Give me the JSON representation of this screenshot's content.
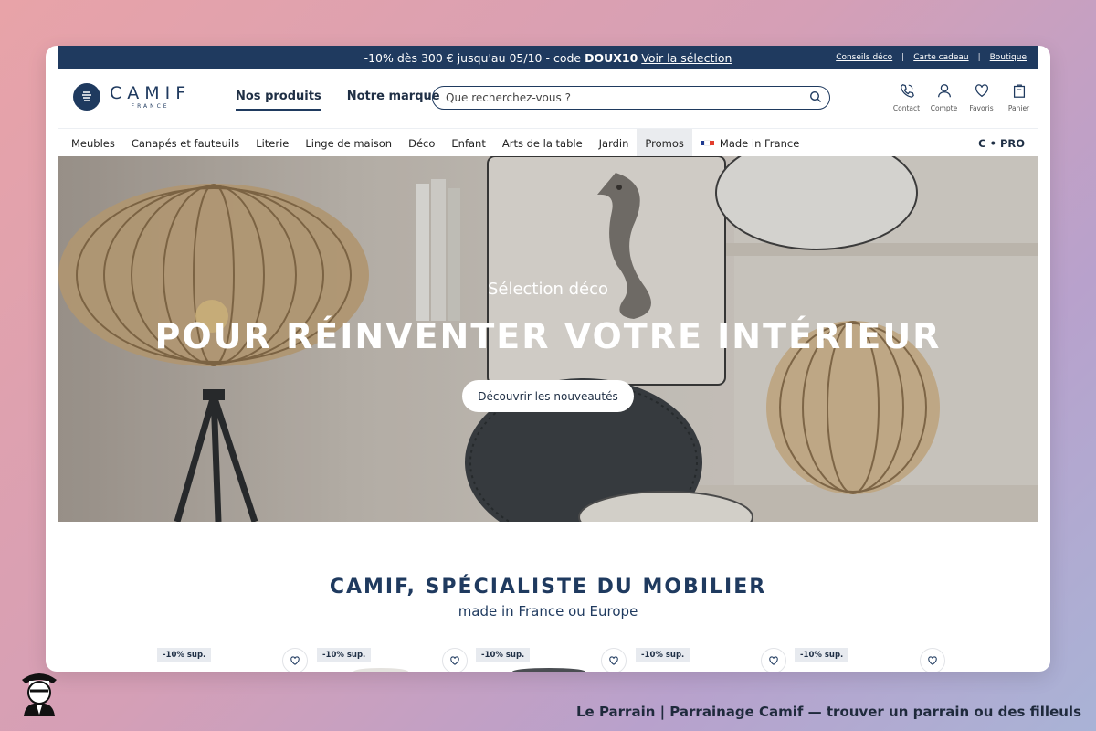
{
  "promo_bar": {
    "text": "-10% dès 300 € jusqu'au 05/10 - code",
    "code": "DOUX10",
    "link": "Voir la sélection",
    "utility_links": [
      "Conseils déco",
      "Carte cadeau",
      "Boutique"
    ],
    "separator": "|"
  },
  "header": {
    "logo": {
      "word": "CAMIF",
      "sub": "FRANCE"
    },
    "main_nav": [
      "Nos produits",
      "Notre marque"
    ],
    "search_placeholder": "Que recherchez-vous ?",
    "actions": [
      {
        "label": "Contact",
        "icon": "phone-icon"
      },
      {
        "label": "Compte",
        "icon": "user-icon"
      },
      {
        "label": "Favoris",
        "icon": "heart-icon"
      },
      {
        "label": "Panier",
        "icon": "bag-icon"
      }
    ]
  },
  "categories": [
    "Meubles",
    "Canapés et fauteuils",
    "Literie",
    "Linge de maison",
    "Déco",
    "Enfant",
    "Arts de la table",
    "Jardin",
    "Promos",
    "Made in France"
  ],
  "cpro_label": "C • PRO",
  "hero": {
    "kicker": "Sélection déco",
    "title": "POUR RÉINVENTER VOTRE INTÉRIEUR",
    "button": "Découvrir les nouveautés"
  },
  "section": {
    "title": "CAMIF, SPÉCIALISTE DU MOBILIER",
    "subtitle": "made in France ou Europe"
  },
  "products": [
    {
      "badge": "-10% sup."
    },
    {
      "badge": "-10% sup."
    },
    {
      "badge": "-10% sup."
    },
    {
      "badge": "-10% sup."
    },
    {
      "badge": "-10% sup."
    }
  ],
  "caption": "Le Parrain | Parrainage Camif — trouver un parrain ou des filleuls",
  "colors": {
    "brand_navy": "#1f3a5f",
    "flag_blue": "#1f3a8f",
    "flag_white": "#ffffff",
    "flag_red": "#e23d2d"
  }
}
